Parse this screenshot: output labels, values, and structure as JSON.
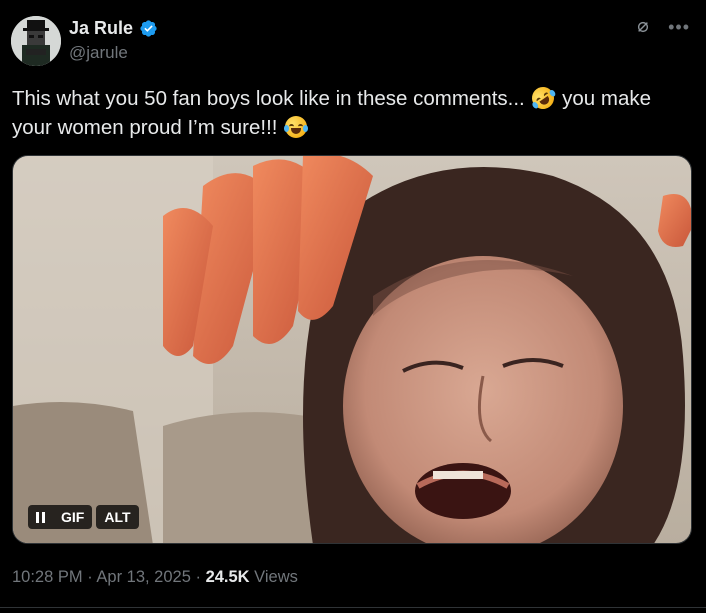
{
  "author": {
    "name": "Ja Rule",
    "handle": "@jarule",
    "verified": true,
    "verified_color": "#1d9bf0"
  },
  "tweet": {
    "text_part1": "This what you 50 fan boys look like in these comments... ",
    "emoji1": "rolling-on-floor-laughing-emoji",
    "text_part2": " you make your women proud I’m sure!!! ",
    "emoji2": "face-with-tears-of-joy-emoji"
  },
  "media": {
    "type": "GIF",
    "pause_label": "pause-icon",
    "gif_label": "GIF",
    "alt_label": "ALT"
  },
  "meta": {
    "time": "10:28 PM",
    "sep1": " · ",
    "date": "Apr 13, 2025",
    "sep2": " · ",
    "views_count": "24.5K",
    "views_label": " Views"
  },
  "icons": {
    "grok": "grok-icon",
    "more": "more-icon"
  },
  "colors": {
    "background": "#000000",
    "text": "#e7e9ea",
    "secondary": "#71767b",
    "accent": "#1d9bf0"
  }
}
